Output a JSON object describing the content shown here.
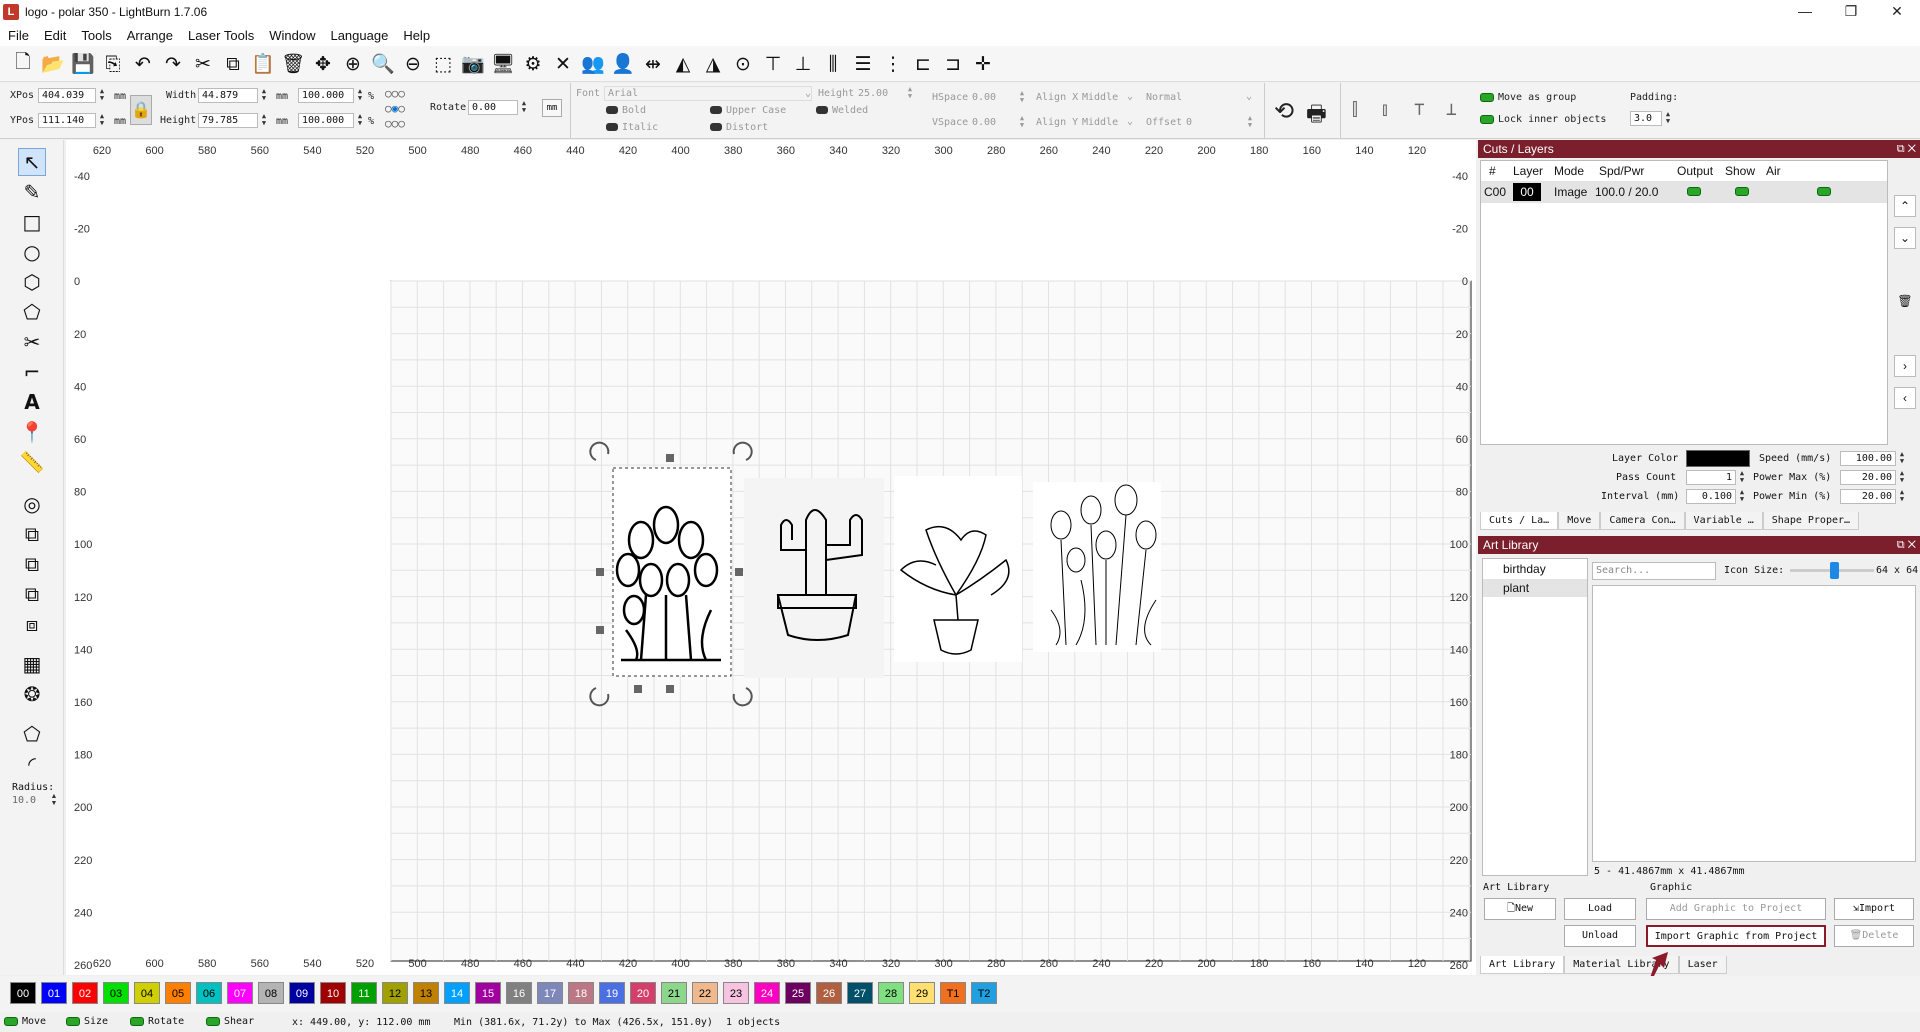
{
  "window": {
    "title": "logo - polar 350 - LightBurn 1.7.06",
    "minimize": "—",
    "maximize": "❐",
    "close": "✕"
  },
  "menu": [
    "File",
    "Edit",
    "Tools",
    "Arrange",
    "Laser Tools",
    "Window",
    "Language",
    "Help"
  ],
  "props": {
    "xpos_label": "XPos",
    "xpos_value": "404.039",
    "ypos_label": "YPos",
    "ypos_value": "111.140",
    "unit": "mm",
    "width_label": "Width",
    "width_value": "44.879",
    "height_label": "Height",
    "height_value": "79.785",
    "scale_w": "100.000",
    "scale_h": "100.000",
    "percent": "%",
    "rotate_label": "Rotate",
    "rotate_value": "0.00",
    "mm_btn": "mm",
    "font_label": "Font",
    "font_value": "Arial",
    "text_height_label": "Height",
    "text_height_value": "25.00",
    "hspace_label": "HSpace",
    "hspace_value": "0.00",
    "vspace_label": "VSpace",
    "vspace_value": "0.00",
    "align_x_label": "Align X",
    "align_x_value": "Middle",
    "align_y_label": "Align Y",
    "align_y_value": "Middle",
    "normal_value": "Normal",
    "offset_label": "Offset",
    "offset_value": "0",
    "bold": "Bold",
    "italic": "Italic",
    "upper_case": "Upper Case",
    "distort": "Distort",
    "welded": "Welded",
    "move_as_group": "Move as group",
    "lock_inner": "Lock inner objects",
    "padding_label": "Padding:",
    "padding_value": "3.0"
  },
  "left_tools": {
    "radius_label": "Radius:",
    "radius_value": "10.0"
  },
  "ruler": {
    "top": [
      "620",
      "600",
      "580",
      "560",
      "540",
      "520",
      "500",
      "480",
      "460",
      "440",
      "420",
      "400",
      "380",
      "360",
      "340",
      "320",
      "300",
      "280",
      "260",
      "240",
      "220",
      "200",
      "180",
      "160",
      "140",
      "120"
    ],
    "bottom": [
      "620",
      "600",
      "580",
      "560",
      "540",
      "520",
      "500",
      "480",
      "460",
      "440",
      "420",
      "400",
      "380",
      "360",
      "340",
      "320",
      "300",
      "280",
      "260",
      "240",
      "220",
      "200",
      "180",
      "160",
      "140",
      "120"
    ],
    "left": [
      "-40",
      "-20",
      "0",
      "20",
      "40",
      "60",
      "80",
      "100",
      "120",
      "140",
      "160",
      "180",
      "200",
      "220",
      "240",
      "260"
    ],
    "right": [
      "-40",
      "-20",
      "0",
      "20",
      "40",
      "60",
      "80",
      "100",
      "120",
      "140",
      "160",
      "180",
      "200",
      "220",
      "240",
      "260"
    ]
  },
  "cuts_layers": {
    "title": "Cuts / Layers",
    "headers": [
      "#",
      "Layer",
      "Mode",
      "Spd/Pwr",
      "Output",
      "Show",
      "Air"
    ],
    "rows": [
      {
        "num": "C00",
        "layer": "00",
        "mode": "Image",
        "spdpwr": "100.0 / 20.0"
      }
    ],
    "layer_color_label": "Layer Color",
    "speed_label": "Speed (mm/s)",
    "speed_value": "100.00",
    "pass_count_label": "Pass Count",
    "pass_count_value": "1",
    "power_max_label": "Power Max (%)",
    "power_max_value": "20.00",
    "interval_label": "Interval (mm)",
    "interval_value": "0.100",
    "power_min_label": "Power Min (%)",
    "power_min_value": "20.00",
    "tabs": [
      "Cuts / La…",
      "Move",
      "Camera Con…",
      "Variable …",
      "Shape Proper…"
    ]
  },
  "art_library": {
    "title": "Art Library",
    "libraries": [
      "birthday",
      "plant"
    ],
    "search_placeholder": "Search...",
    "icon_size_label": "Icon Size:",
    "icon_size_value": "64 x 64",
    "icon_size_fraction": 0.52,
    "selection_info": "5 - 41.4867mm x 41.4867mm",
    "section_art": "Art Library",
    "section_graphic": "Graphic",
    "new": "New",
    "load": "Load",
    "unload": "Unload",
    "add_graphic": "Add Graphic to Project",
    "import": "Import",
    "import_from_project": "Import Graphic from Project",
    "delete": "Delete",
    "tabs": [
      "Art Library",
      "Material Library",
      "Laser"
    ]
  },
  "palette": [
    {
      "label": "00",
      "color": "#000000",
      "text": "#ffffff"
    },
    {
      "label": "01",
      "color": "#0000ff",
      "text": "#ffffff"
    },
    {
      "label": "02",
      "color": "#ff0000",
      "text": "#ffffff"
    },
    {
      "label": "03",
      "color": "#00e000",
      "text": "#000000"
    },
    {
      "label": "04",
      "color": "#d0d000",
      "text": "#000000"
    },
    {
      "label": "05",
      "color": "#ff8000",
      "text": "#000000"
    },
    {
      "label": "06",
      "color": "#00c0c0",
      "text": "#000000"
    },
    {
      "label": "07",
      "color": "#ff00ff",
      "text": "#ffffff"
    },
    {
      "label": "08",
      "color": "#b4b4b4",
      "text": "#000000"
    },
    {
      "label": "09",
      "color": "#0000a0",
      "text": "#ffffff"
    },
    {
      "label": "10",
      "color": "#a00000",
      "text": "#ffffff"
    },
    {
      "label": "11",
      "color": "#00a000",
      "text": "#ffffff"
    },
    {
      "label": "12",
      "color": "#a0a000",
      "text": "#000000"
    },
    {
      "label": "13",
      "color": "#c08000",
      "text": "#000000"
    },
    {
      "label": "14",
      "color": "#00a0ff",
      "text": "#ffffff"
    },
    {
      "label": "15",
      "color": "#a000a0",
      "text": "#ffffff"
    },
    {
      "label": "16",
      "color": "#808080",
      "text": "#ffffff"
    },
    {
      "label": "17",
      "color": "#7d87b9",
      "text": "#ffffff"
    },
    {
      "label": "18",
      "color": "#bb7784",
      "text": "#ffffff"
    },
    {
      "label": "19",
      "color": "#4a6fe3",
      "text": "#ffffff"
    },
    {
      "label": "20",
      "color": "#d33f6a",
      "text": "#ffffff"
    },
    {
      "label": "21",
      "color": "#8cd78c",
      "text": "#000000"
    },
    {
      "label": "22",
      "color": "#f0b98d",
      "text": "#000000"
    },
    {
      "label": "23",
      "color": "#f6c4e1",
      "text": "#000000"
    },
    {
      "label": "24",
      "color": "#fe00c0",
      "text": "#ffffff"
    },
    {
      "label": "25",
      "color": "#6b0060",
      "text": "#ffffff"
    },
    {
      "label": "26",
      "color": "#b06040",
      "text": "#ffffff"
    },
    {
      "label": "27",
      "color": "#00506a",
      "text": "#ffffff"
    },
    {
      "label": "28",
      "color": "#80e080",
      "text": "#000000"
    },
    {
      "label": "29",
      "color": "#ffe070",
      "text": "#000000"
    },
    {
      "label": "T1",
      "color": "#f07020",
      "text": "#000000"
    },
    {
      "label": "T2",
      "color": "#20a0e0",
      "text": "#000000"
    }
  ],
  "status": {
    "move": "Move",
    "size": "Size",
    "rotate": "Rotate",
    "shear": "Shear",
    "coords": "x: 449.00, y: 112.00 mm",
    "bounds": "Min (381.6x, 71.2y) to Max (426.5x, 151.0y)",
    "objects": "1 objects"
  }
}
